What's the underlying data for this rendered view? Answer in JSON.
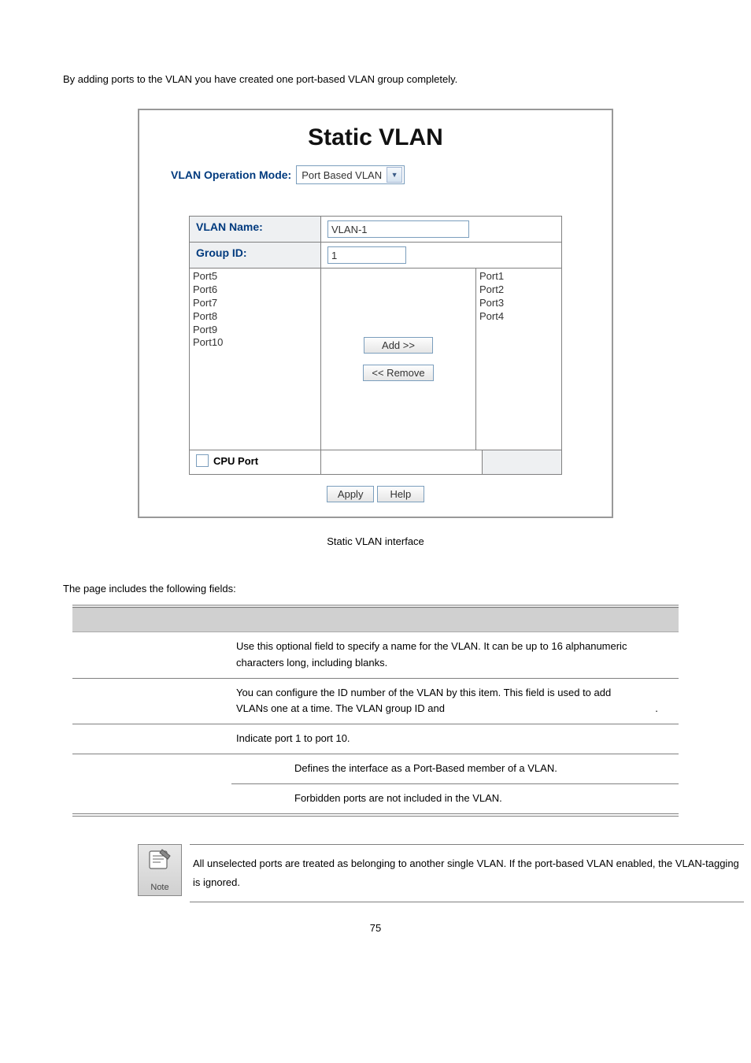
{
  "intro_text": "By adding ports to the VLAN you have created one port-based VLAN group completely.",
  "panel": {
    "title": "Static VLAN",
    "mode_label": "VLAN Operation Mode:",
    "mode_value": "Port Based VLAN",
    "vlan_name_label": "VLAN Name:",
    "vlan_name_value": "VLAN-1",
    "group_id_label": "Group ID:",
    "group_id_value": "1",
    "left_ports": [
      "Port5",
      "Port6",
      "Port7",
      "Port8",
      "Port9",
      "Port10"
    ],
    "right_ports": [
      "Port1",
      "Port2",
      "Port3",
      "Port4"
    ],
    "btn_add": "Add   >>",
    "btn_remove": "<< Remove",
    "cpu_port_label": "CPU Port",
    "btn_apply": "Apply",
    "btn_help": "Help"
  },
  "figure_caption": "Static VLAN interface",
  "fields_intro": "The page includes the following fields:",
  "fields": {
    "vlan_name_desc": "Use this optional field to specify a name for the VLAN. It can be up to 16 alphanumeric characters long, including blanks.",
    "group_id_desc_a": "You can configure the ID number of the VLAN by this item. This field is used to add",
    "group_id_desc_b": "VLANs one at a time. The VLAN group ID and",
    "group_id_desc_c": ".",
    "port_desc": "Indicate port 1 to port 10.",
    "member_desc": "Defines the interface as a Port-Based member of a VLAN.",
    "forbidden_desc": "Forbidden ports are not included in the VLAN."
  },
  "note_label": "Note",
  "note_text": "All unselected ports are treated as belonging to another single VLAN. If the port-based VLAN enabled, the VLAN-tagging is ignored.",
  "page_number": "75"
}
